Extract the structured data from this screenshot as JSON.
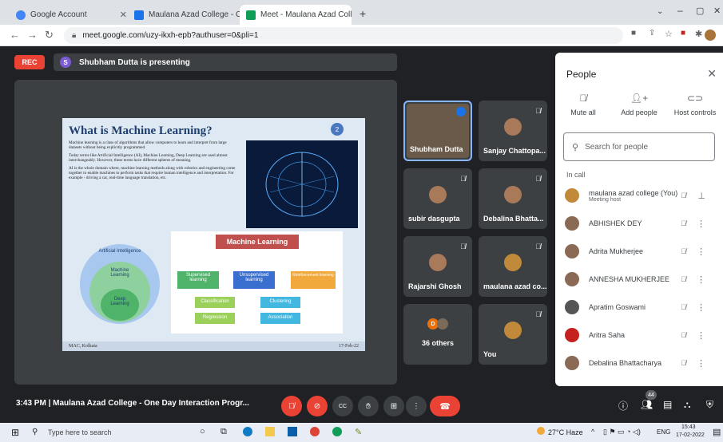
{
  "tabs": [
    {
      "label": "Google Account",
      "fav_color": "#4285f4"
    },
    {
      "label": "Maulana Azad College - Calenda",
      "fav_color": "#1a73e8"
    },
    {
      "label": "Meet - Maulana Azad Colleg",
      "fav_color": "#0f9d58"
    }
  ],
  "url": "meet.google.com/uzy-ikxh-epb?authuser=0&pli=1",
  "recording": "REC",
  "presenter": {
    "initial": "S",
    "text": "Shubham Dutta is presenting"
  },
  "slide": {
    "title": "What is Machine Learning?",
    "page": "2",
    "bullets": [
      "Machine learning is a class of algorithms that allow computers to learn and interpret from large datasets without being explicitly programmed.",
      "Today terms like Artificial Intelligence (AI), Machine Learning, Deep Learning are used almost interchangeably. However, these terms have different spheres of meaning.",
      "AI is the whole domain where, machine learning methods along with robotics and engineering come together to enable machines to perform tasks that require human intelligence and interpretation. For example - driving a car, real-time language translation, etc."
    ],
    "venn": [
      "Artificial Intelligence",
      "Machine Learning",
      "Deep Learning"
    ],
    "diagram_title": "Machine Learning",
    "branches": [
      "Supervised learning",
      "Unsupervised learning",
      "Reinforcement learning"
    ],
    "leaves": [
      "Classification",
      "Regression",
      "Clustering",
      "Association"
    ],
    "footer_left": "MAC, Kolkata",
    "footer_right": "17-Feb-22"
  },
  "tiles": [
    {
      "name": "Shubham Dutta"
    },
    {
      "name": "Sanjay Chattopa..."
    },
    {
      "name": "subir dasgupta"
    },
    {
      "name": "Debalina Bhatta..."
    },
    {
      "name": "Rajarshi Ghosh"
    },
    {
      "name": "maulana azad co..."
    },
    {
      "name": "36 others"
    },
    {
      "name": "You"
    }
  ],
  "people": {
    "title": "People",
    "actions": [
      "Mute all",
      "Add people",
      "Host controls"
    ],
    "search_placeholder": "Search for people",
    "section": "In call",
    "list": [
      {
        "name": "maulana azad college (You)",
        "sub": "Meeting host"
      },
      {
        "name": "ABHISHEK DEY",
        "sub": ""
      },
      {
        "name": "Adrita Mukherjee",
        "sub": ""
      },
      {
        "name": "ANNESHA MUKHERJEE",
        "sub": ""
      },
      {
        "name": "Apratim Goswami",
        "sub": ""
      },
      {
        "name": "Aritra Saha",
        "sub": ""
      },
      {
        "name": "Debalina Bhattacharya",
        "sub": ""
      }
    ]
  },
  "controls": {
    "time_info": "3:43 PM  |  Maulana Azad College - One Day Interaction Progr...",
    "participants_badge": "44"
  },
  "taskbar": {
    "search": "Type here to search",
    "weather": "27°C Haze",
    "lang": "ENG",
    "time": "15:43",
    "date": "17-02-2022"
  }
}
